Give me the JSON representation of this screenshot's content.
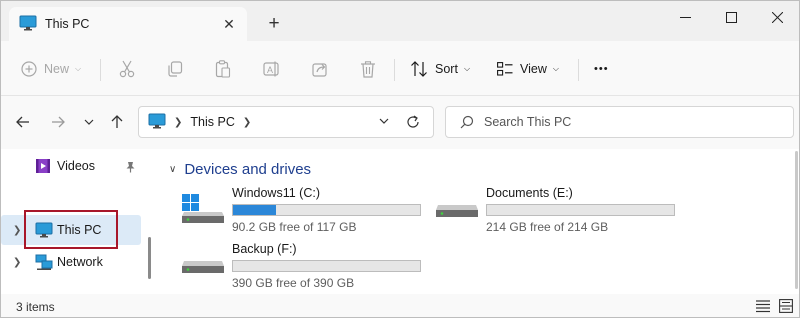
{
  "tab": {
    "title": "This PC",
    "close_glyph": "✕",
    "new_tab_glyph": "+"
  },
  "window_controls": {
    "minimize": "minimize-icon",
    "maximize": "maximize-icon",
    "close": "close-icon"
  },
  "commands": {
    "new_label": "New",
    "sort_label": "Sort",
    "view_label": "View",
    "more_glyph": "•••",
    "icons": [
      "cut-icon",
      "copy-icon",
      "paste-icon",
      "rename-icon",
      "share-icon",
      "delete-icon"
    ]
  },
  "address": {
    "location": "This PC",
    "search_placeholder": "Search This PC"
  },
  "sidebar": {
    "items": [
      {
        "label": "Videos",
        "icon": "videos-icon",
        "pinned": true
      },
      {
        "label": "This PC",
        "icon": "monitor-icon",
        "selected": true
      },
      {
        "label": "Network",
        "icon": "network-icon"
      }
    ]
  },
  "content": {
    "group_title": "Devices and drives",
    "drives": [
      {
        "name": "Windows11 (C:)",
        "free_text": "90.2 GB free of 117 GB",
        "used_fraction": 0.23,
        "windows_logo": true
      },
      {
        "name": "Documents (E:)",
        "free_text": "214 GB free of 214 GB",
        "used_fraction": 0.0
      },
      {
        "name": "Backup (F:)",
        "free_text": "390 GB free of 390 GB",
        "used_fraction": 0.0
      }
    ]
  },
  "status": {
    "item_count": "3 items"
  },
  "colors": {
    "accent": "#2b87d8",
    "group_heading": "#1f3f8f",
    "selection": "#dceaf7",
    "highlight_box": "#a8172a"
  }
}
